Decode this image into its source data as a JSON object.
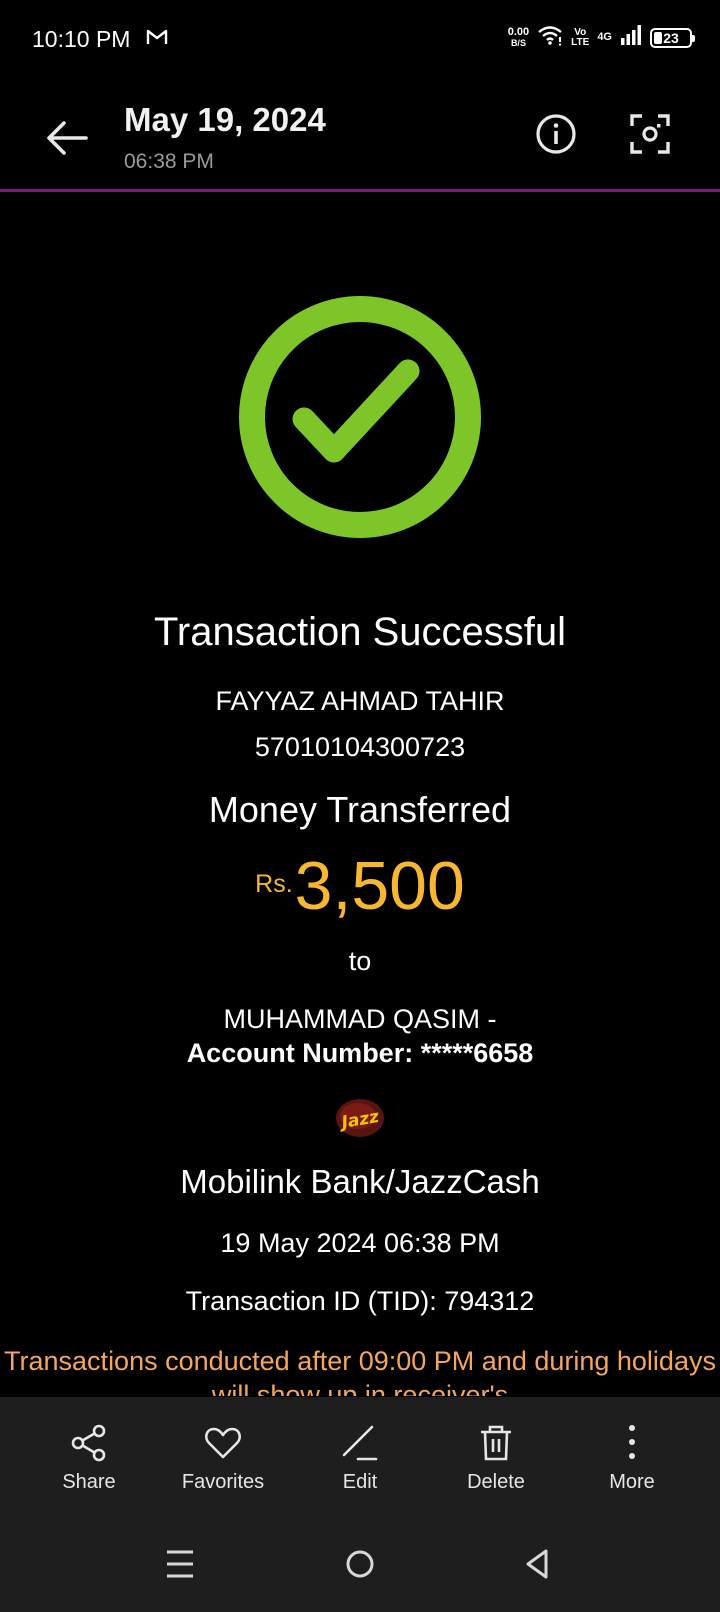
{
  "status_bar": {
    "time": "10:10 PM",
    "net_speed_value": "0.00",
    "net_speed_unit": "B/S",
    "volte_top": "Vo",
    "volte_bottom": "LTE",
    "network": "4G",
    "battery": "23"
  },
  "header": {
    "title": "May 19, 2024",
    "subtitle": "06:38 PM"
  },
  "receipt": {
    "status": "Transaction Successful",
    "sender_name": "FAYYAZ AHMAD TAHIR",
    "sender_account": "57010104300723",
    "action": "Money Transferred",
    "currency": "Rs.",
    "amount": "3,500",
    "to": "to",
    "receiver_name": "MUHAMMAD QASIM -",
    "receiver_account": "Account Number: *****6658",
    "logo_text": "Jazz",
    "bank": "Mobilink Bank/JazzCash",
    "datetime": "19 May 2024 06:38 PM",
    "tid": "Transaction ID (TID): 794312",
    "note": "Transactions conducted after 09:00 PM and during holidays will show up in receiver's"
  },
  "actions": {
    "share": "Share",
    "favorites": "Favorites",
    "edit": "Edit",
    "delete": "Delete",
    "more": "More"
  },
  "colors": {
    "accent_line": "#7b1a7e",
    "success_green": "#7ec52a",
    "amount_gold": "#f7b731",
    "note_orange": "#f5a65b"
  }
}
